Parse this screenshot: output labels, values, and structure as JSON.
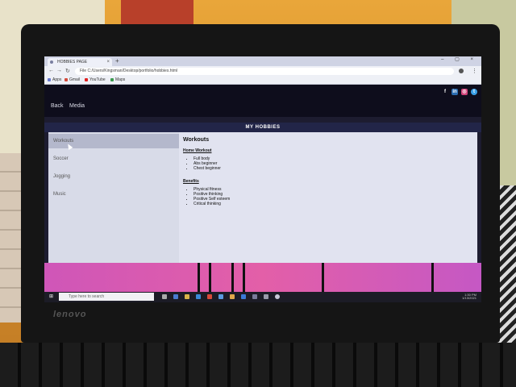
{
  "browser": {
    "tab_title": "HOBBIES PAGE",
    "new_tab": "+",
    "close": "×",
    "window_controls": "–  ▢  ×",
    "url": "C:/Users/Kingsman/Desktop/portfolio/hobbies.html",
    "url_prefix": "File",
    "bookmarks": [
      {
        "label": "Apps",
        "color": "#6a7bd0"
      },
      {
        "label": "Gmail",
        "color": "#d34a3b"
      },
      {
        "label": "YouTube",
        "color": "#e02020"
      },
      {
        "label": "Maps",
        "color": "#3b9a4e"
      }
    ]
  },
  "site": {
    "nav": [
      "Back",
      "Media"
    ],
    "social_icons": [
      "facebook-icon",
      "linkedin-icon",
      "instagram-icon",
      "twitter-icon"
    ],
    "social_glyphs": [
      "f",
      "in",
      "◎",
      "t"
    ],
    "page_title": "MY HOBBIES",
    "sidebar": [
      "Workouts",
      "Soccer",
      "Jogging",
      "Music"
    ],
    "active_index": 0
  },
  "content": {
    "heading": "Workouts",
    "section1_title": "Home Workout",
    "section1_items": [
      "Full body",
      "Abs beginner",
      "Chest beginner"
    ],
    "section2_title": "Benefits",
    "section2_items": [
      "Physical fitness",
      "Positive thinking",
      "Positive Self esteem",
      "Critical thinking"
    ]
  },
  "taskbar": {
    "search_placeholder": "Type here to search",
    "time": "1:30 PM",
    "date": "1/13/2021"
  },
  "laptop": {
    "brand": "lenovo"
  },
  "colors": {
    "header": "#0e0d1c",
    "title_bar": "#222548",
    "sunset": "#e35fa8"
  }
}
